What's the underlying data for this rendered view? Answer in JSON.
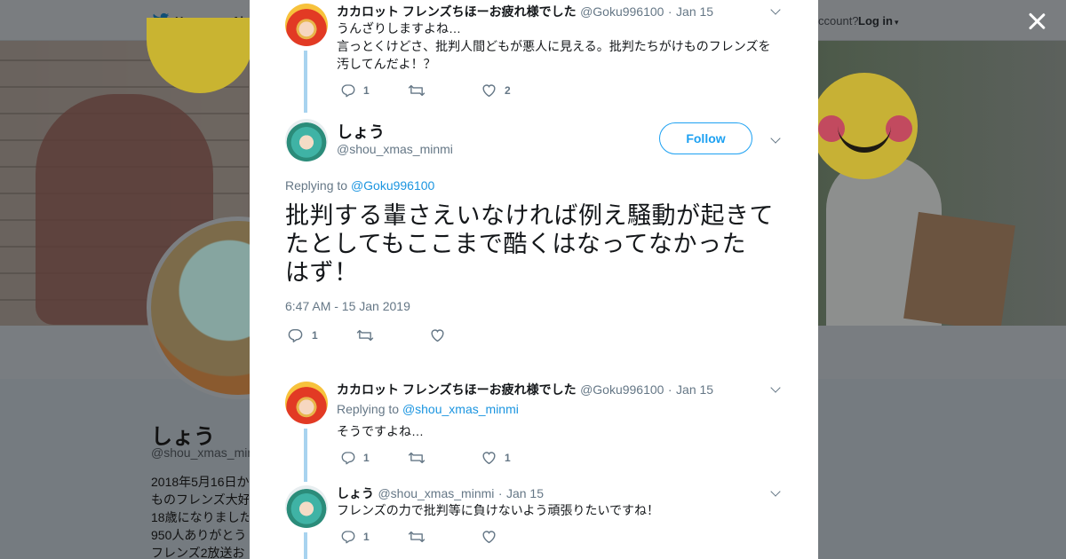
{
  "background": {
    "nav": {
      "home": "Home",
      "about": "Abo",
      "account_prompt": "ccount?",
      "login": "Log in"
    },
    "profile": {
      "name": "しょう",
      "handle": "@shou_xmas_minmi",
      "bio_lines": [
        "2018年5月16日か",
        "ものフレンズ大好",
        "18歳になりました",
        "950人ありがとう",
        "フレンズ2放送お"
      ]
    }
  },
  "tweets": [
    {
      "author": "カカロット フレンズちほーお疲れ様でした",
      "handle": "@Goku996100",
      "date": "Jan 15",
      "text_lines": [
        "うんざりしますよね…",
        "言っとくけどさ、批判人間どもが悪人に見える。批判たちがけものフレンズを",
        "汚してんだよ！？"
      ],
      "replies": "1",
      "retweets": "",
      "likes": "2"
    },
    {
      "author": "カカロット フレンズちほーお疲れ様でした",
      "handle": "@Goku996100",
      "date": "Jan 15",
      "replying_label": "Replying to",
      "replying_to": "@shou_xmas_minmi",
      "text_lines": [
        "そうですよね…"
      ],
      "replies": "1",
      "retweets": "",
      "likes": "1"
    },
    {
      "author": "しょう",
      "handle": "@shou_xmas_minmi",
      "date": "Jan 15",
      "text_lines": [
        "フレンズの力で批判等に負けないよう頑張りたいですね！"
      ],
      "replies": "1",
      "retweets": "",
      "likes": ""
    }
  ],
  "main_tweet": {
    "name": "しょう",
    "handle": "@shou_xmas_minmi",
    "follow_label": "Follow",
    "replying_label": "Replying to",
    "replying_to": "@Goku996100",
    "text_lines": [
      "批判する輩さえいなければ例え騒動が起きて",
      "たとしてもここまで酷くはなってなかった",
      "はず！"
    ],
    "timestamp": "6:47 AM - 15 Jan 2019",
    "replies": "1",
    "retweets": "",
    "likes": ""
  },
  "colors": {
    "accent": "#1da1f2",
    "link": "#1b95e0",
    "thread_line": "#a8d3ef",
    "muted": "#657786"
  },
  "icons": [
    "twitter-bird-icon",
    "close-icon",
    "reply-icon",
    "retweet-icon",
    "heart-icon",
    "chevron-down-icon"
  ]
}
